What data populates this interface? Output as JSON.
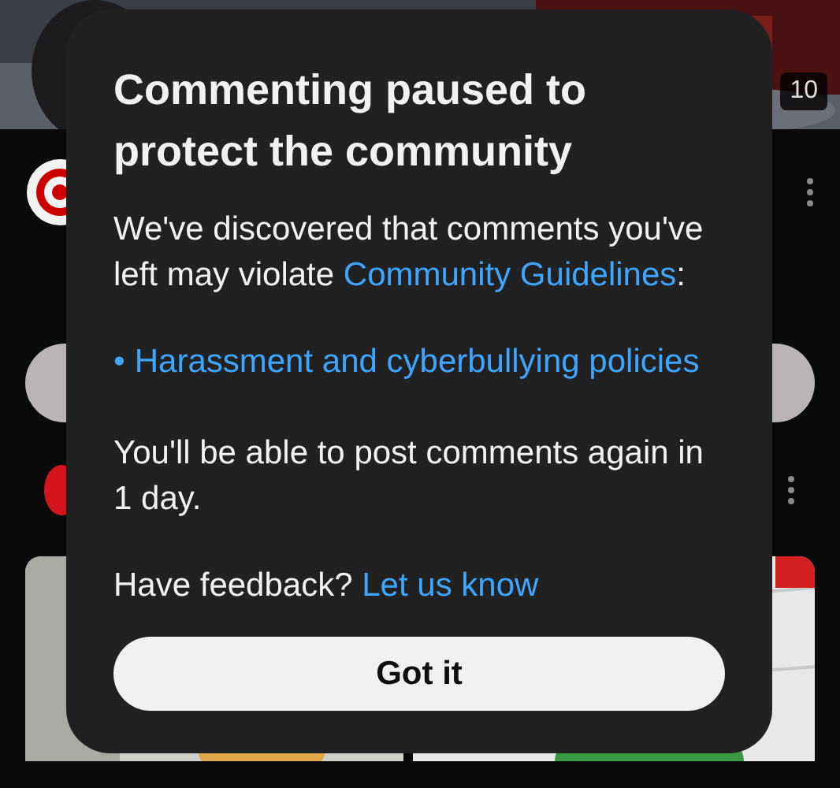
{
  "background": {
    "timestamp": "10"
  },
  "dialog": {
    "title": "Commenting paused to protect the community",
    "intro": [
      {
        "kind": "text",
        "text": "We've discovered that comments you've left may violate "
      },
      {
        "kind": "link",
        "text": "Community Guidelines"
      },
      {
        "kind": "text",
        "text": ":"
      }
    ],
    "policies": [
      {
        "marker": "•",
        "text": "Harassment and cyberbullying policies"
      }
    ],
    "notice": "You'll be able to post comments again in 1 day.",
    "feedback": [
      {
        "kind": "text",
        "text": "Have feedback? "
      },
      {
        "kind": "link",
        "text": "Let us know"
      }
    ],
    "button": "Got it"
  }
}
